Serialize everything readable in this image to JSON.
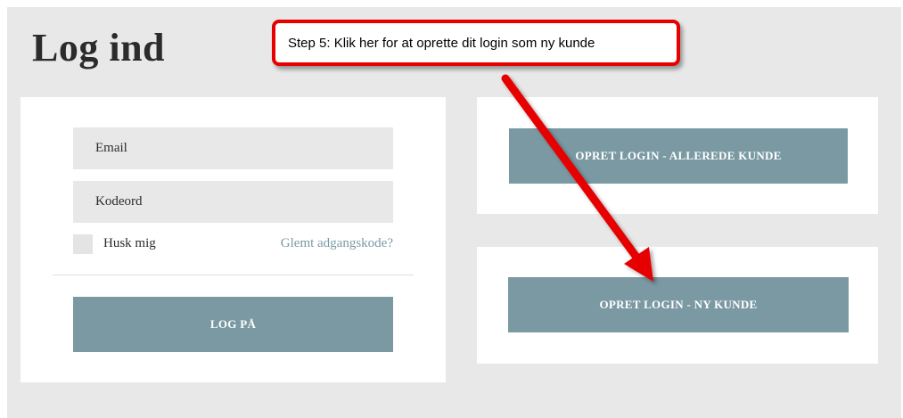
{
  "page": {
    "title": "Log ind"
  },
  "login_form": {
    "email_placeholder": "Email",
    "password_placeholder": "Kodeord",
    "remember_label": "Husk mig",
    "forgot_link": "Glemt adgangskode?",
    "submit_label": "LOG PÅ"
  },
  "register": {
    "existing_customer_label": "OPRET LOGIN - ALLEREDE KUNDE",
    "new_customer_label": "OPRET LOGIN - NY KUNDE"
  },
  "annotation": {
    "text": "Step 5: Klik her for at oprette dit login som ny kunde",
    "color": "#e60000"
  },
  "colors": {
    "background": "#e8e8e8",
    "button": "#7a99a3",
    "link": "#7a9aa4"
  }
}
